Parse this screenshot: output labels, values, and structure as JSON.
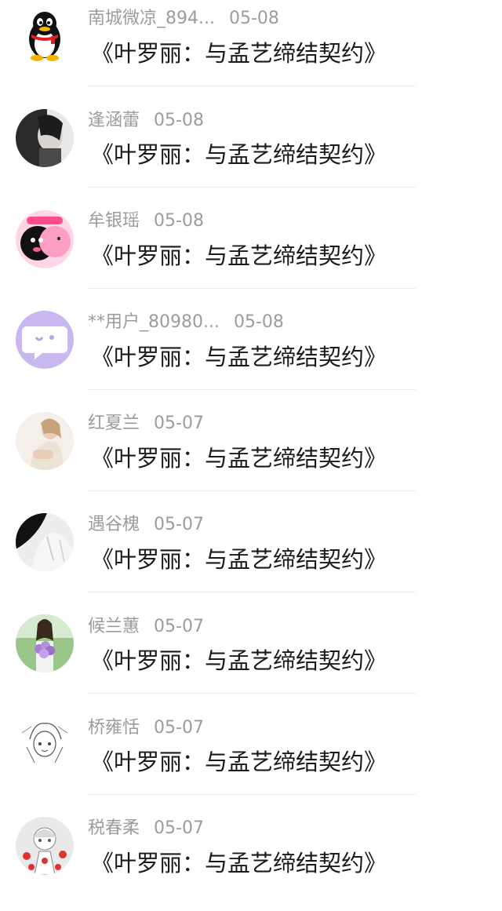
{
  "comments": [
    {
      "user": "南城微凉_894...",
      "date": "05-08",
      "text": "《叶罗丽：与孟艺缔结契约》",
      "avatar_icon": "qq-penguin-avatar"
    },
    {
      "user": "逢涵蕾",
      "date": "05-08",
      "text": "《叶罗丽：与孟艺缔结契约》",
      "avatar_icon": "photo-avatar"
    },
    {
      "user": "牟银瑶",
      "date": "05-08",
      "text": "《叶罗丽：与孟艺缔结契约》",
      "avatar_icon": "cartoon-avatar"
    },
    {
      "user": "**用户_80980...",
      "date": "05-08",
      "text": "《叶罗丽：与孟艺缔结契约》",
      "avatar_icon": "chat-bubble-avatar"
    },
    {
      "user": "红夏兰",
      "date": "05-07",
      "text": "《叶罗丽：与孟艺缔结契约》",
      "avatar_icon": "photo-avatar"
    },
    {
      "user": "遇谷槐",
      "date": "05-07",
      "text": "《叶罗丽：与孟艺缔结契约》",
      "avatar_icon": "photo-avatar"
    },
    {
      "user": "候兰蕙",
      "date": "05-07",
      "text": "《叶罗丽：与孟艺缔结契约》",
      "avatar_icon": "photo-avatar"
    },
    {
      "user": "桥雍恬",
      "date": "05-07",
      "text": "《叶罗丽：与孟艺缔结契约》",
      "avatar_icon": "sketch-avatar"
    },
    {
      "user": "税春柔",
      "date": "05-07",
      "text": "《叶罗丽：与孟艺缔结契约》",
      "avatar_icon": "illustration-avatar"
    }
  ],
  "colors": {
    "meta_text": "#9c9c9c",
    "title_text": "#1a1a1a",
    "divider": "#ececec",
    "chat_avatar_bg": "#c9b8f0"
  }
}
